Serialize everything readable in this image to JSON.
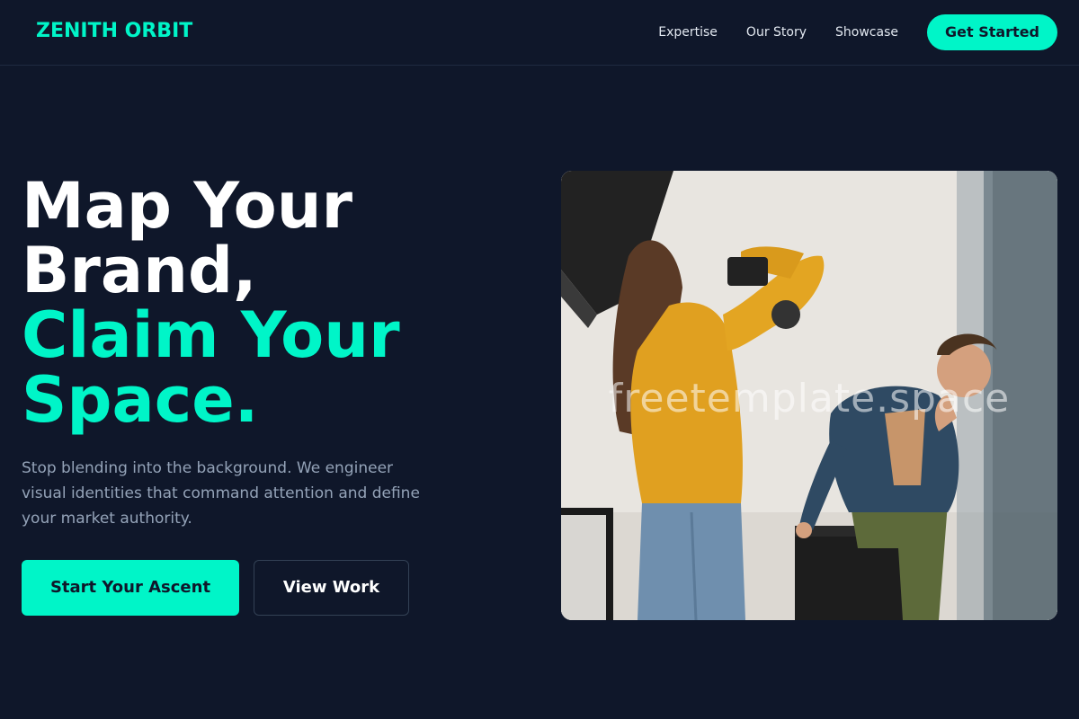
{
  "brand": {
    "logo_text": "ZENITH ORBIT",
    "accent_color": "#00f5c8",
    "background_color": "#0f172a"
  },
  "nav": {
    "items": [
      {
        "label": "Expertise"
      },
      {
        "label": "Our Story"
      },
      {
        "label": "Showcase"
      }
    ],
    "cta_label": "Get Started"
  },
  "hero": {
    "title_line1": "Map Your",
    "title_line2": "Brand,",
    "title_line3": "Claim Your",
    "title_line4": "Space.",
    "description": "Stop blending into the background. We engineer visual identities that command attention and define your market authority.",
    "primary_button": "Start Your Ascent",
    "secondary_button": "View Work",
    "image": {
      "watermark": "freetemplate.space"
    }
  }
}
